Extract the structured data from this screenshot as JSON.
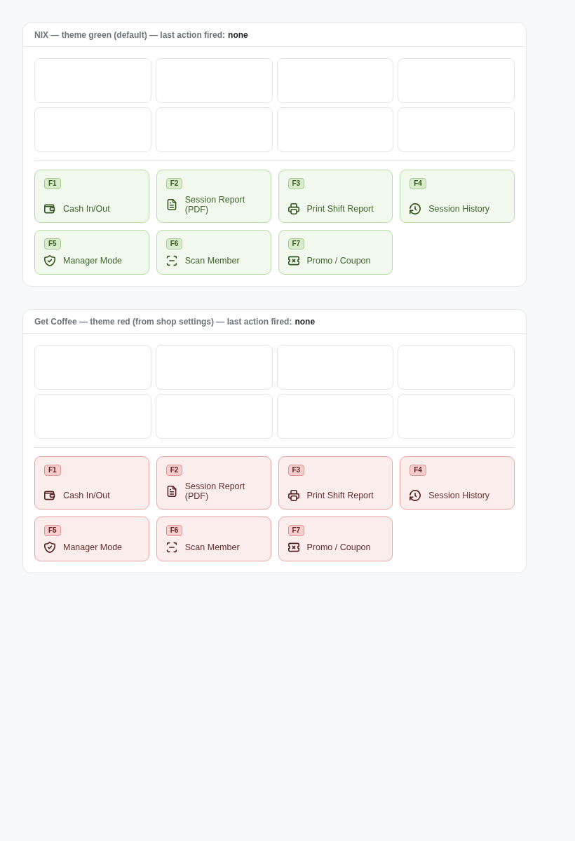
{
  "panels": [
    {
      "color": "#b8dca3",
      "title": "NIX — theme green (default) — last action fired:",
      "last_action": "none",
      "slots": [
        {
          "kind": "empty"
        },
        {
          "kind": "empty"
        },
        {
          "kind": "empty"
        },
        {
          "kind": "empty"
        },
        {
          "kind": "empty"
        },
        {
          "kind": "empty"
        },
        {
          "kind": "empty"
        },
        {
          "kind": "empty"
        }
      ],
      "actions": [
        {
          "key": "F1",
          "label": "Cash In/Out",
          "kind": "cash"
        },
        {
          "key": "F2",
          "label": "Session Report (PDF)",
          "kind": "report"
        },
        {
          "key": "F3",
          "label": "Print Shift Report",
          "kind": "print"
        },
        {
          "key": "F4",
          "label": "Session History",
          "kind": "history"
        },
        {
          "key": "F5",
          "label": "Manager Mode",
          "kind": "manager"
        },
        {
          "key": "F6",
          "label": "Scan Member",
          "kind": "scan"
        },
        {
          "key": "F7",
          "label": "Promo / Coupon",
          "kind": "promo"
        }
      ]
    },
    {
      "color": "#efa3a3",
      "title": "Get Coffee — theme red (from shop settings) — last action fired:",
      "last_action": "none",
      "slots": [
        {
          "kind": "empty"
        },
        {
          "kind": "empty"
        },
        {
          "kind": "empty"
        },
        {
          "kind": "empty"
        },
        {
          "kind": "empty"
        },
        {
          "kind": "empty"
        },
        {
          "kind": "empty"
        },
        {
          "kind": "empty"
        }
      ],
      "actions": [
        {
          "key": "F1",
          "label": "Cash In/Out",
          "kind": "cash"
        },
        {
          "key": "F2",
          "label": "Session Report (PDF)",
          "kind": "report"
        },
        {
          "key": "F3",
          "label": "Print Shift Report",
          "kind": "print"
        },
        {
          "key": "F4",
          "label": "Session History",
          "kind": "history"
        },
        {
          "key": "F5",
          "label": "Manager Mode",
          "kind": "manager"
        },
        {
          "key": "F6",
          "label": "Scan Member",
          "kind": "scan"
        },
        {
          "key": "F7",
          "label": "Promo / Coupon",
          "kind": "promo"
        }
      ]
    }
  ]
}
